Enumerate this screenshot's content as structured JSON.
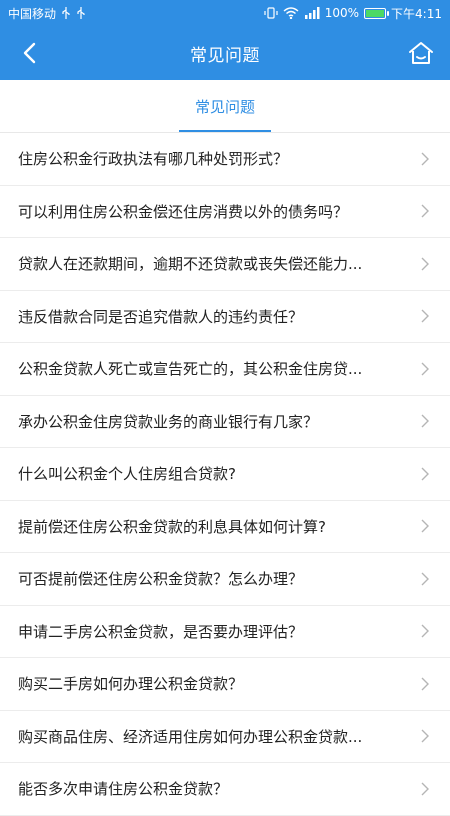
{
  "status_bar": {
    "carrier": "中国移动",
    "battery": "100%",
    "time": "下午4:11",
    "icons": [
      "usb-icon",
      "usb-icon",
      "vibrate-icon",
      "wifi-icon",
      "signal-icon",
      "battery-icon"
    ]
  },
  "app_bar": {
    "title": "常见问题",
    "left_icon": "back-arrow-icon",
    "right_icon": "home-icon",
    "background": "#2f8ee3"
  },
  "tabs": [
    {
      "label": "常见问题",
      "active": true
    }
  ],
  "faq": [
    {
      "question": "住房公积金行政执法有哪几种处罚形式？"
    },
    {
      "question": "可以利用住房公积金偿还住房消费以外的债务吗？"
    },
    {
      "question": "贷款人在还款期间，逾期不还贷款或丧失偿还能力..."
    },
    {
      "question": "违反借款合同是否追究借款人的违约责任？"
    },
    {
      "question": "公积金贷款人死亡或宣告死亡的，其公积金住房贷..."
    },
    {
      "question": "承办公积金住房贷款业务的商业银行有几家？"
    },
    {
      "question": "什么叫公积金个人住房组合贷款?"
    },
    {
      "question": "提前偿还住房公积金贷款的利息具体如何计算?"
    },
    {
      "question": "可否提前偿还住房公积金贷款？怎么办理？"
    },
    {
      "question": "申请二手房公积金贷款，是否要办理评估？"
    },
    {
      "question": "购买二手房如何办理公积金贷款？"
    },
    {
      "question": "购买商品住房、经济适用住房如何办理公积金贷款..."
    },
    {
      "question": "能否多次申请住房公积金贷款？"
    }
  ],
  "colors": {
    "accent": "#2f8ee3",
    "divider": "#ececec",
    "text": "#222222",
    "chevron": "#b5b5b5"
  }
}
